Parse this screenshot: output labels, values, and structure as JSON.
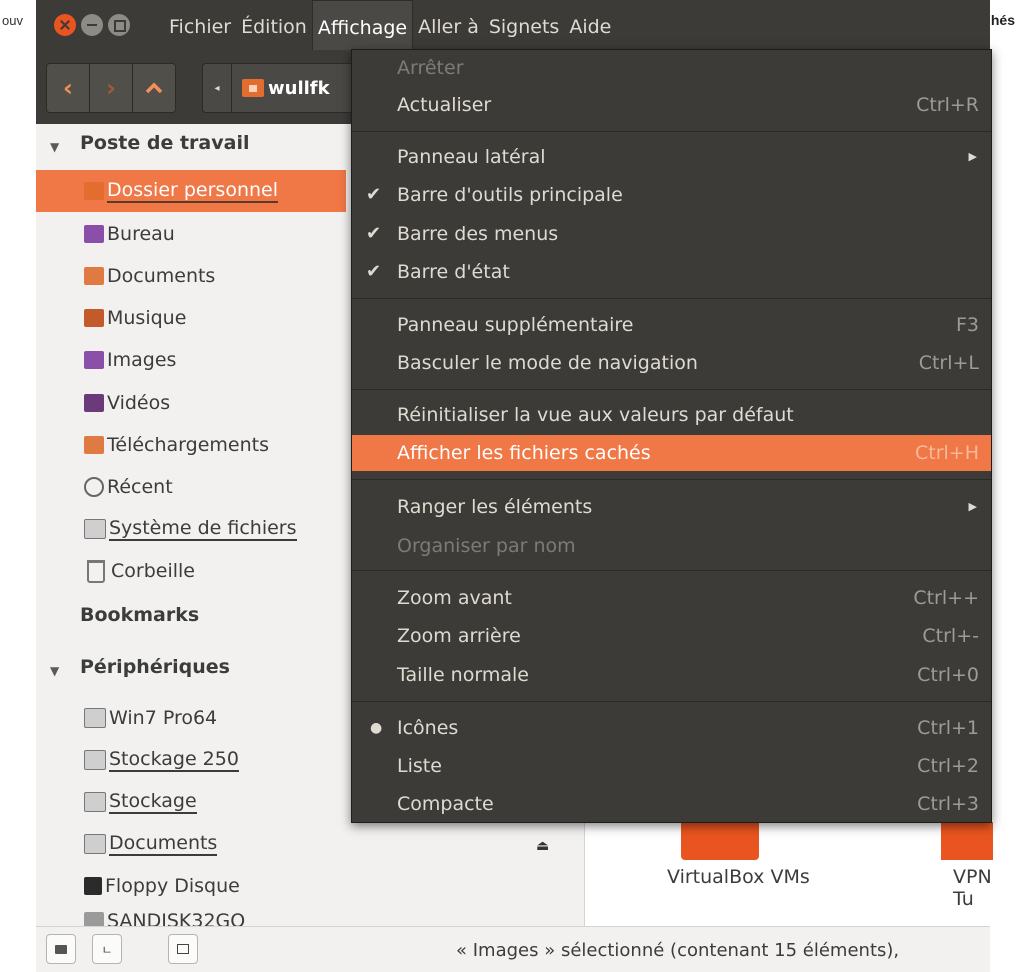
{
  "outer": {
    "left_text": "ouv",
    "right_text": "hés"
  },
  "menubar": [
    "Fichier",
    "Édition",
    "Affichage",
    "Aller à",
    "Signets",
    "Aide"
  ],
  "toolbar": {
    "path_label": "wullfk"
  },
  "sidebar": {
    "sections": {
      "workspace": "Poste de travail",
      "bookmarks": "Bookmarks",
      "devices": "Périphériques"
    },
    "places": [
      {
        "label": "Dossier personnel",
        "icon": "home-folder-icon"
      },
      {
        "label": "Bureau",
        "icon": "desktop-folder-icon"
      },
      {
        "label": "Documents",
        "icon": "documents-folder-icon"
      },
      {
        "label": "Musique",
        "icon": "music-folder-icon"
      },
      {
        "label": "Images",
        "icon": "pictures-folder-icon"
      },
      {
        "label": "Vidéos",
        "icon": "videos-folder-icon"
      },
      {
        "label": "Téléchargements",
        "icon": "downloads-folder-icon"
      },
      {
        "label": "Récent",
        "icon": "recent-icon"
      },
      {
        "label": "Système de fichiers",
        "icon": "drive-icon"
      },
      {
        "label": "Corbeille",
        "icon": "trash-icon"
      }
    ],
    "devices": [
      {
        "label": "Win7 Pro64",
        "icon": "drive-icon"
      },
      {
        "label": "Stockage 250",
        "icon": "drive-icon"
      },
      {
        "label": "Stockage",
        "icon": "drive-icon"
      },
      {
        "label": "Documents",
        "icon": "drive-icon"
      },
      {
        "label": "Floppy Disque",
        "icon": "floppy-icon"
      },
      {
        "label": "SANDISK32GO",
        "icon": "usb-icon"
      }
    ]
  },
  "content": {
    "items": [
      "VirtualBox VMs",
      "VPN Tu"
    ]
  },
  "dropdown": {
    "items": [
      {
        "label": "Arrêter",
        "shortcut": "",
        "disabled": true
      },
      {
        "label": "Actualiser",
        "shortcut": "Ctrl+R"
      },
      {
        "label": "Panneau latéral",
        "submenu": true
      },
      {
        "label": "Barre d'outils principale",
        "checked": true
      },
      {
        "label": "Barre des menus",
        "checked": true
      },
      {
        "label": "Barre d'état",
        "checked": true
      },
      {
        "label": "Panneau supplémentaire",
        "shortcut": "F3"
      },
      {
        "label": "Basculer le mode de navigation",
        "shortcut": "Ctrl+L"
      },
      {
        "label": "Réinitialiser la vue aux valeurs par défaut",
        "shortcut": ""
      },
      {
        "label": "Afficher les fichiers cachés",
        "shortcut": "Ctrl+H",
        "highlighted": true
      },
      {
        "label": "Ranger les éléments",
        "submenu": true
      },
      {
        "label": "Organiser par nom",
        "disabled": true
      },
      {
        "label": "Zoom avant",
        "shortcut": "Ctrl++"
      },
      {
        "label": "Zoom arrière",
        "shortcut": "Ctrl+-"
      },
      {
        "label": "Taille normale",
        "shortcut": "Ctrl+0"
      },
      {
        "label": "Icônes",
        "shortcut": "Ctrl+1",
        "radio": true
      },
      {
        "label": "Liste",
        "shortcut": "Ctrl+2"
      },
      {
        "label": "Compacte",
        "shortcut": "Ctrl+3"
      }
    ]
  },
  "statusbar": {
    "text": "« Images » sélectionné (contenant 15 éléments),"
  },
  "colors": {
    "accent": "#f07746",
    "ubuntu_orange": "#e95420",
    "menu_bg": "#3c3b37"
  }
}
